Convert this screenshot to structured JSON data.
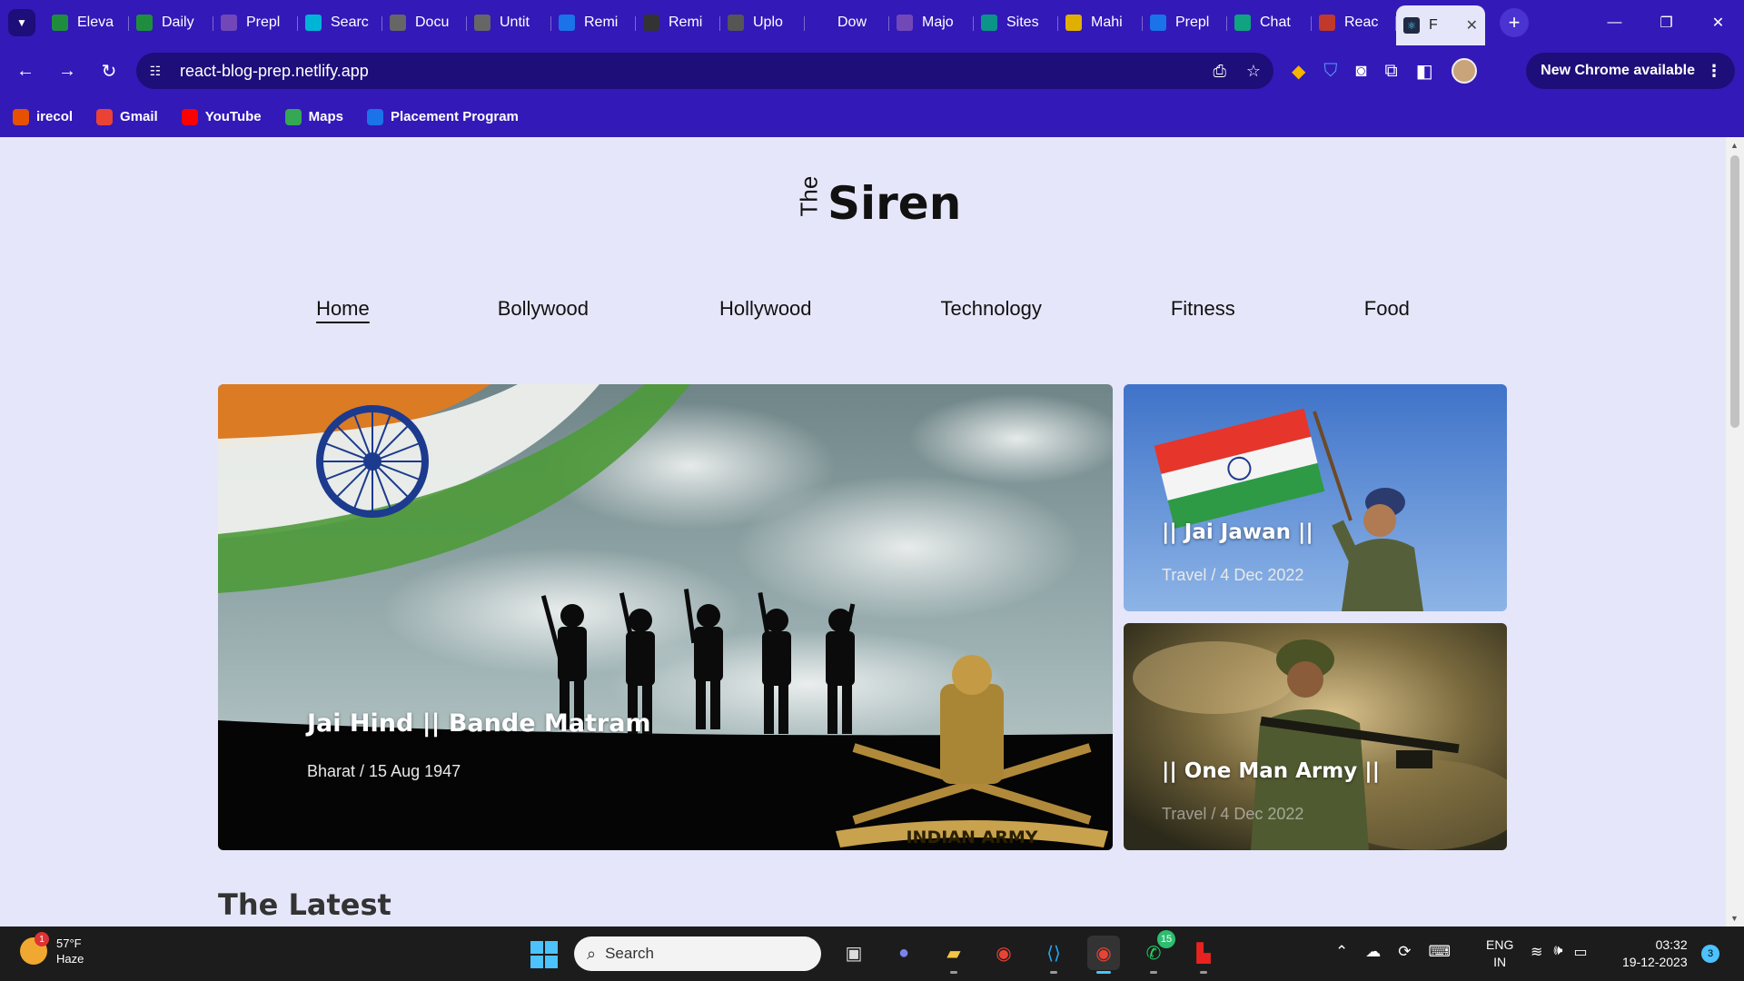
{
  "browser": {
    "tabs": [
      {
        "label": "Eleva",
        "icon": "sheets-icon",
        "color": "#1e8e3e"
      },
      {
        "label": "Daily",
        "icon": "sheets-icon",
        "color": "#1e8e3e"
      },
      {
        "label": "Prepl",
        "icon": "forms-icon",
        "color": "#7248b9"
      },
      {
        "label": "Searc",
        "icon": "vercel-icon",
        "color": "#00b4d8"
      },
      {
        "label": "Docu",
        "icon": "globe-icon",
        "color": "#666666"
      },
      {
        "label": "Untit",
        "icon": "globe-icon",
        "color": "#666666"
      },
      {
        "label": "Remi",
        "icon": "doc-icon",
        "color": "#1a73e8"
      },
      {
        "label": "Remi",
        "icon": "github-icon",
        "color": "#333333"
      },
      {
        "label": "Uplo",
        "icon": "layers-icon",
        "color": "#555555"
      },
      {
        "label": "Dow",
        "icon": "download-icon",
        "color": "#3319b8"
      },
      {
        "label": "Majo",
        "icon": "forms-icon",
        "color": "#7248b9"
      },
      {
        "label": "Sites",
        "icon": "diamond-icon",
        "color": "#0b9488"
      },
      {
        "label": "Mahi",
        "icon": "smile-icon",
        "color": "#e0b000"
      },
      {
        "label": "Prepl",
        "icon": "pb-icon",
        "color": "#1a73e8"
      },
      {
        "label": "Chat",
        "icon": "chatgpt-icon",
        "color": "#10a37f"
      },
      {
        "label": "Reac",
        "icon": "react-icon",
        "color": "#c0392b"
      }
    ],
    "active_tab": {
      "label": "F",
      "icon": "react-icon",
      "close": "✕"
    },
    "new_tab": "+",
    "url": "react-blog-prep.netlify.app",
    "update_button": "New Chrome available",
    "bookmarks": [
      {
        "label": "irecol",
        "icon": "irecol-icon",
        "color": "#e65100"
      },
      {
        "label": "Gmail",
        "icon": "gmail-icon",
        "color": "#ea4335"
      },
      {
        "label": "YouTube",
        "icon": "youtube-icon",
        "color": "#ff0000"
      },
      {
        "label": "Maps",
        "icon": "maps-icon",
        "color": "#34a853"
      },
      {
        "label": "Placement Program",
        "icon": "pb-icon",
        "color": "#1a73e8"
      }
    ]
  },
  "site": {
    "logo_small": "The",
    "logo_big": "Siren",
    "nav": [
      "Home",
      "Bollywood",
      "Hollywood",
      "Technology",
      "Fitness",
      "Food"
    ],
    "active_nav": "Home",
    "hero_main": {
      "title": "Jai Hind || Bande Matram",
      "meta": "Bharat / 15 Aug 1947",
      "badge_text": "INDIAN ARMY"
    },
    "hero_side_1": {
      "title": "|| Jai Jawan ||",
      "meta": "Travel / 4 Dec 2022"
    },
    "hero_side_2": {
      "title": "|| One Man Army ||",
      "meta": "Travel / 4 Dec 2022"
    },
    "latest_heading": "The Latest"
  },
  "taskbar": {
    "weather_temp": "57°F",
    "weather_desc": "Haze",
    "weather_badge": "1",
    "search_placeholder": "Search",
    "whatsapp_badge": "15",
    "lang_line1": "ENG",
    "lang_line2": "IN",
    "time": "03:32",
    "date": "19-12-2023",
    "notification_count": "3"
  }
}
